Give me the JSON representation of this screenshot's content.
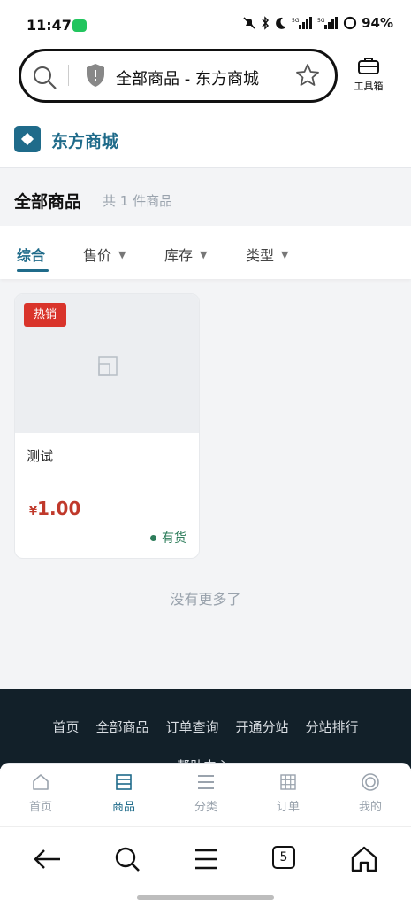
{
  "status": {
    "time": "11:47",
    "battery": "94%"
  },
  "browser": {
    "url_title": "全部商品 - 东方商城",
    "toolbox_label": "工具箱",
    "tab_count": "5"
  },
  "site": {
    "brand": "东方商城"
  },
  "page": {
    "title": "全部商品",
    "count_text": "共 1 件商品"
  },
  "sort_tabs": [
    {
      "label": "综合",
      "caret": ""
    },
    {
      "label": "售价",
      "caret": "▼"
    },
    {
      "label": "库存",
      "caret": "▼"
    },
    {
      "label": "类型",
      "caret": "▼"
    }
  ],
  "products": [
    {
      "badge": "热销",
      "name": "测试",
      "currency": "¥",
      "price": "1.00",
      "stock": "有货"
    }
  ],
  "no_more": "没有更多了",
  "footer": {
    "links": [
      "首页",
      "全部商品",
      "订单查询",
      "开通分站",
      "分站排行"
    ],
    "help": "帮助中心"
  },
  "app_nav": [
    {
      "label": "首页",
      "icon": "home-icon"
    },
    {
      "label": "商品",
      "icon": "list-icon"
    },
    {
      "label": "分类",
      "icon": "menu-icon"
    },
    {
      "label": "订单",
      "icon": "grid-icon"
    },
    {
      "label": "我的",
      "icon": "user-icon"
    }
  ],
  "colors": {
    "accent": "#1f6b8a",
    "price": "#c0392b",
    "badge": "#d9342b",
    "stock": "#2e7d5b",
    "footer_bg": "#122029"
  }
}
